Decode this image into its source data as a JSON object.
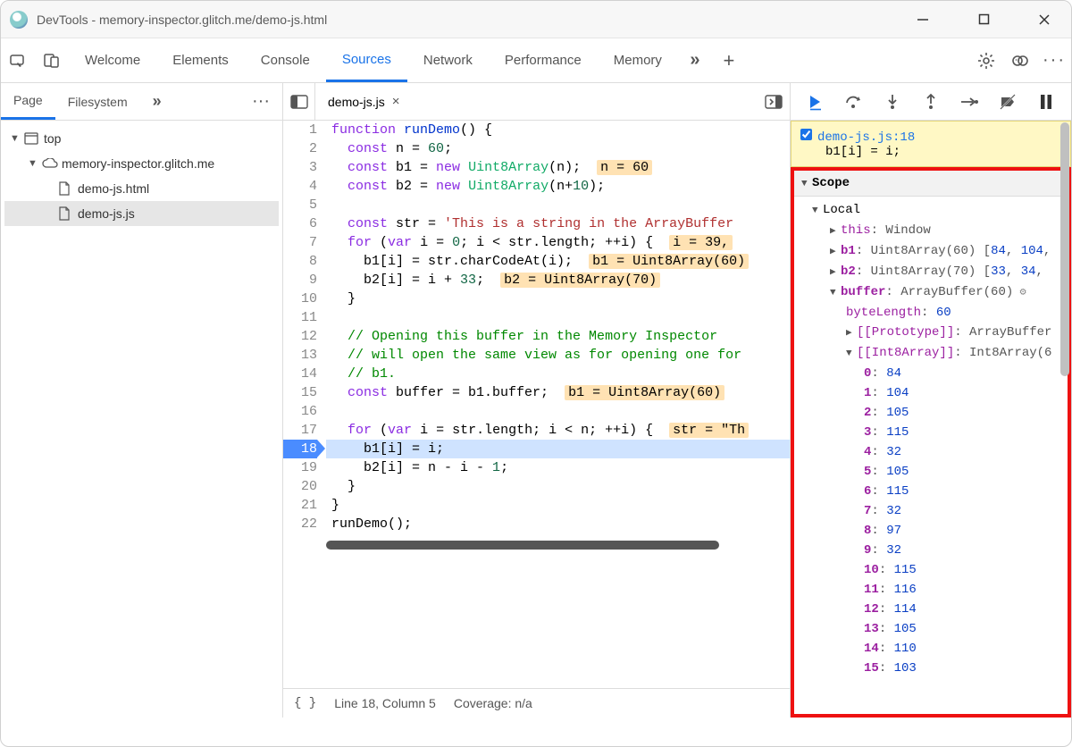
{
  "window": {
    "title": "DevTools - memory-inspector.glitch.me/demo-js.html"
  },
  "mainTabs": [
    "Welcome",
    "Elements",
    "Console",
    "Sources",
    "Network",
    "Performance",
    "Memory"
  ],
  "mainActive": "Sources",
  "navTabs": {
    "active": "Page",
    "other": "Filesystem"
  },
  "tree": {
    "top": "top",
    "domain": "memory-inspector.glitch.me",
    "files": [
      "demo-js.html",
      "demo-js.js"
    ],
    "selected": "demo-js.js"
  },
  "editor": {
    "tab": "demo-js.js",
    "status": {
      "braces": "{ }",
      "pos": "Line 18, Column 5",
      "cov": "Coverage: n/a"
    },
    "lines": [
      {
        "n": 1,
        "pre": "",
        "segs": [
          [
            "kw",
            "function"
          ],
          [
            "",
            " "
          ],
          [
            "def",
            "runDemo"
          ],
          [
            "",
            "() {"
          ]
        ]
      },
      {
        "n": 2,
        "pre": "  ",
        "segs": [
          [
            "kw",
            "const"
          ],
          [
            "",
            " n = "
          ],
          [
            "num",
            "60"
          ],
          [
            "",
            ";"
          ]
        ]
      },
      {
        "n": 3,
        "pre": "  ",
        "segs": [
          [
            "kw",
            "const"
          ],
          [
            "",
            " b1 = "
          ],
          [
            "kw",
            "new"
          ],
          [
            "",
            " "
          ],
          [
            "typ",
            "Uint8Array"
          ],
          [
            "",
            "(n);  "
          ],
          [
            "inline",
            "n = 60"
          ]
        ]
      },
      {
        "n": 4,
        "pre": "  ",
        "segs": [
          [
            "kw",
            "const"
          ],
          [
            "",
            " b2 = "
          ],
          [
            "kw",
            "new"
          ],
          [
            "",
            " "
          ],
          [
            "typ",
            "Uint8Array"
          ],
          [
            "",
            "(n+"
          ],
          [
            "num",
            "10"
          ],
          [
            "",
            ");"
          ]
        ]
      },
      {
        "n": 5,
        "pre": "",
        "segs": [
          [
            "",
            ""
          ]
        ]
      },
      {
        "n": 6,
        "pre": "  ",
        "segs": [
          [
            "kw",
            "const"
          ],
          [
            "",
            " str = "
          ],
          [
            "str",
            "'This is a string in the ArrayBuffer"
          ]
        ]
      },
      {
        "n": 7,
        "pre": "  ",
        "segs": [
          [
            "kw",
            "for"
          ],
          [
            "",
            " ("
          ],
          [
            "kw",
            "var"
          ],
          [
            "",
            " i = "
          ],
          [
            "num",
            "0"
          ],
          [
            "",
            "; i < str.length; ++i) {  "
          ],
          [
            "inline",
            "i = 39,"
          ]
        ]
      },
      {
        "n": 8,
        "pre": "    ",
        "segs": [
          [
            "",
            "b1[i] = str.charCodeAt(i);  "
          ],
          [
            "inline",
            "b1 = Uint8Array(60)"
          ]
        ]
      },
      {
        "n": 9,
        "pre": "    ",
        "segs": [
          [
            "",
            "b2[i] = i + "
          ],
          [
            "num",
            "33"
          ],
          [
            "",
            ";  "
          ],
          [
            "inline",
            "b2 = Uint8Array(70)"
          ]
        ]
      },
      {
        "n": 10,
        "pre": "  ",
        "segs": [
          [
            "",
            "}"
          ]
        ]
      },
      {
        "n": 11,
        "pre": "",
        "segs": [
          [
            "",
            ""
          ]
        ]
      },
      {
        "n": 12,
        "pre": "  ",
        "segs": [
          [
            "cmt",
            "// Opening this buffer in the Memory Inspector"
          ]
        ]
      },
      {
        "n": 13,
        "pre": "  ",
        "segs": [
          [
            "cmt",
            "// will open the same view as for opening one for"
          ]
        ]
      },
      {
        "n": 14,
        "pre": "  ",
        "segs": [
          [
            "cmt",
            "// b1."
          ]
        ]
      },
      {
        "n": 15,
        "pre": "  ",
        "segs": [
          [
            "kw",
            "const"
          ],
          [
            "",
            " buffer = b1.buffer;  "
          ],
          [
            "inline",
            "b1 = Uint8Array(60)"
          ]
        ]
      },
      {
        "n": 16,
        "pre": "",
        "segs": [
          [
            "",
            ""
          ]
        ]
      },
      {
        "n": 17,
        "pre": "  ",
        "segs": [
          [
            "kw",
            "for"
          ],
          [
            "",
            " ("
          ],
          [
            "kw",
            "var"
          ],
          [
            "",
            " i = str.length; i < n; ++i) {  "
          ],
          [
            "inline",
            "str = \"Th"
          ]
        ]
      },
      {
        "n": 18,
        "pre": "    ",
        "segs": [
          [
            "",
            "b1[i] = i;"
          ]
        ],
        "hl": true
      },
      {
        "n": 19,
        "pre": "    ",
        "segs": [
          [
            "",
            "b2[i] = n - i - "
          ],
          [
            "num",
            "1"
          ],
          [
            "",
            ";"
          ]
        ]
      },
      {
        "n": 20,
        "pre": "  ",
        "segs": [
          [
            "",
            "}"
          ]
        ]
      },
      {
        "n": 21,
        "pre": "",
        "segs": [
          [
            "",
            "}"
          ]
        ]
      },
      {
        "n": 22,
        "pre": "",
        "segs": [
          [
            "",
            "runDemo();"
          ]
        ]
      }
    ]
  },
  "debug": {
    "breakpoint": {
      "src": "demo-js.js:18",
      "line": "b1[i] = i;"
    },
    "scopeTitle": "Scope",
    "local": "Local",
    "this": {
      "k": "this",
      "v": "Window"
    },
    "b1": {
      "k": "b1",
      "t": "Uint8Array(60)",
      "vals": "[84, 104,"
    },
    "b2": {
      "k": "b2",
      "t": "Uint8Array(70)",
      "vals": "[33, 34,"
    },
    "buffer": {
      "k": "buffer",
      "t": "ArrayBuffer(60)"
    },
    "byteLength": {
      "k": "byteLength",
      "v": "60"
    },
    "proto": {
      "k": "[[Prototype]]",
      "v": "ArrayBuffer"
    },
    "int8": {
      "k": "[[Int8Array]]",
      "v": "Int8Array(6"
    },
    "arr": [
      {
        "k": "0",
        "v": "84"
      },
      {
        "k": "1",
        "v": "104"
      },
      {
        "k": "2",
        "v": "105"
      },
      {
        "k": "3",
        "v": "115"
      },
      {
        "k": "4",
        "v": "32"
      },
      {
        "k": "5",
        "v": "105"
      },
      {
        "k": "6",
        "v": "115"
      },
      {
        "k": "7",
        "v": "32"
      },
      {
        "k": "8",
        "v": "97"
      },
      {
        "k": "9",
        "v": "32"
      },
      {
        "k": "10",
        "v": "115"
      },
      {
        "k": "11",
        "v": "116"
      },
      {
        "k": "12",
        "v": "114"
      },
      {
        "k": "13",
        "v": "105"
      },
      {
        "k": "14",
        "v": "110"
      },
      {
        "k": "15",
        "v": "103"
      }
    ]
  }
}
